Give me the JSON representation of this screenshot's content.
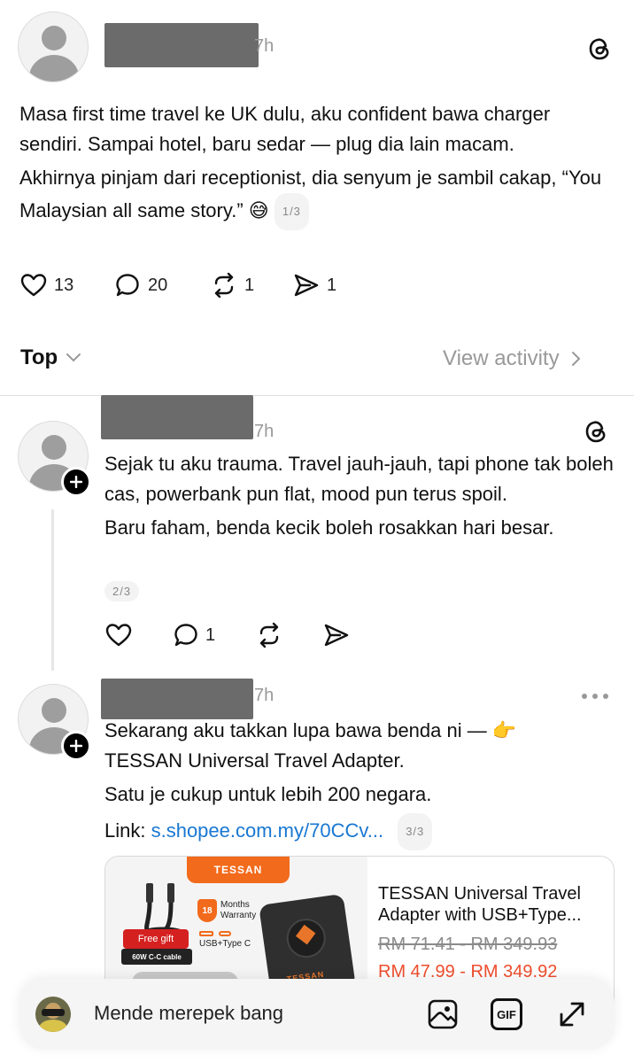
{
  "post1": {
    "time": "7h",
    "paragraphs": [
      "Masa first time travel ke UK dulu, aku confident bawa charger sendiri. Sampai hotel, baru sedar — plug dia lain macam.",
      "Akhirnya pinjam dari receptionist, dia senyum je sambil cakap, “You Malaysian all same story.” 😅"
    ],
    "page_indicator": "1/3",
    "likes": "13",
    "replies": "20",
    "reposts": "1",
    "shares": "1"
  },
  "sort": {
    "label": "Top",
    "view_activity": "View activity"
  },
  "post2": {
    "time": "7h",
    "paragraphs": [
      "Sejak tu aku trauma. Travel jauh-jauh, tapi phone tak boleh cas, powerbank pun flat, mood pun terus spoil.",
      "Baru faham, benda kecik boleh rosakkan hari besar."
    ],
    "page_indicator": "2/3",
    "replies": "1"
  },
  "post3": {
    "time": "7h",
    "line1": "Sekarang aku takkan lupa bawa benda ni — 👉",
    "line2": "TESSAN Universal Travel Adapter.",
    "line3": "Satu je cukup untuk lebih 200 negara.",
    "link_label": "Link: ",
    "link_url": "s.shopee.com.my/70CCv...",
    "page_indicator": "3/3"
  },
  "product_card": {
    "brand": "TESSAN",
    "warranty_number": "18",
    "warranty_text": "Months Warranty",
    "usb_label": "USB+Type C",
    "free_gift": "Free gift",
    "cable_label": "60W C-C cable",
    "title": "TESSAN Universal Travel Adapter with USB+Type...",
    "old_price": "RM 71.41 - RM 349.93",
    "new_price": "RM 47.99 - RM 349.92"
  },
  "composer": {
    "placeholder": "Mende merepek bang",
    "gif_label": "GIF"
  },
  "colors": {
    "link": "#1877d2",
    "price": "#ee4d2d",
    "tessan_orange": "#f26a1b"
  }
}
